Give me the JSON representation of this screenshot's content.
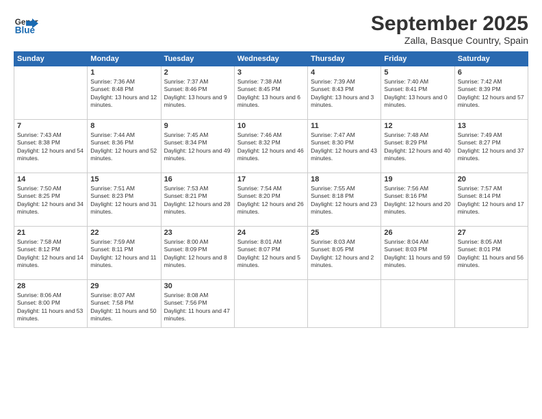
{
  "header": {
    "logo_general": "General",
    "logo_blue": "Blue",
    "title": "September 2025",
    "subtitle": "Zalla, Basque Country, Spain"
  },
  "days_of_week": [
    "Sunday",
    "Monday",
    "Tuesday",
    "Wednesday",
    "Thursday",
    "Friday",
    "Saturday"
  ],
  "weeks": [
    [
      {
        "date": "",
        "info": ""
      },
      {
        "date": "1",
        "sunrise": "Sunrise: 7:36 AM",
        "sunset": "Sunset: 8:48 PM",
        "daylight": "Daylight: 13 hours and 12 minutes."
      },
      {
        "date": "2",
        "sunrise": "Sunrise: 7:37 AM",
        "sunset": "Sunset: 8:46 PM",
        "daylight": "Daylight: 13 hours and 9 minutes."
      },
      {
        "date": "3",
        "sunrise": "Sunrise: 7:38 AM",
        "sunset": "Sunset: 8:45 PM",
        "daylight": "Daylight: 13 hours and 6 minutes."
      },
      {
        "date": "4",
        "sunrise": "Sunrise: 7:39 AM",
        "sunset": "Sunset: 8:43 PM",
        "daylight": "Daylight: 13 hours and 3 minutes."
      },
      {
        "date": "5",
        "sunrise": "Sunrise: 7:40 AM",
        "sunset": "Sunset: 8:41 PM",
        "daylight": "Daylight: 13 hours and 0 minutes."
      },
      {
        "date": "6",
        "sunrise": "Sunrise: 7:42 AM",
        "sunset": "Sunset: 8:39 PM",
        "daylight": "Daylight: 12 hours and 57 minutes."
      }
    ],
    [
      {
        "date": "7",
        "sunrise": "Sunrise: 7:43 AM",
        "sunset": "Sunset: 8:38 PM",
        "daylight": "Daylight: 12 hours and 54 minutes."
      },
      {
        "date": "8",
        "sunrise": "Sunrise: 7:44 AM",
        "sunset": "Sunset: 8:36 PM",
        "daylight": "Daylight: 12 hours and 52 minutes."
      },
      {
        "date": "9",
        "sunrise": "Sunrise: 7:45 AM",
        "sunset": "Sunset: 8:34 PM",
        "daylight": "Daylight: 12 hours and 49 minutes."
      },
      {
        "date": "10",
        "sunrise": "Sunrise: 7:46 AM",
        "sunset": "Sunset: 8:32 PM",
        "daylight": "Daylight: 12 hours and 46 minutes."
      },
      {
        "date": "11",
        "sunrise": "Sunrise: 7:47 AM",
        "sunset": "Sunset: 8:30 PM",
        "daylight": "Daylight: 12 hours and 43 minutes."
      },
      {
        "date": "12",
        "sunrise": "Sunrise: 7:48 AM",
        "sunset": "Sunset: 8:29 PM",
        "daylight": "Daylight: 12 hours and 40 minutes."
      },
      {
        "date": "13",
        "sunrise": "Sunrise: 7:49 AM",
        "sunset": "Sunset: 8:27 PM",
        "daylight": "Daylight: 12 hours and 37 minutes."
      }
    ],
    [
      {
        "date": "14",
        "sunrise": "Sunrise: 7:50 AM",
        "sunset": "Sunset: 8:25 PM",
        "daylight": "Daylight: 12 hours and 34 minutes."
      },
      {
        "date": "15",
        "sunrise": "Sunrise: 7:51 AM",
        "sunset": "Sunset: 8:23 PM",
        "daylight": "Daylight: 12 hours and 31 minutes."
      },
      {
        "date": "16",
        "sunrise": "Sunrise: 7:53 AM",
        "sunset": "Sunset: 8:21 PM",
        "daylight": "Daylight: 12 hours and 28 minutes."
      },
      {
        "date": "17",
        "sunrise": "Sunrise: 7:54 AM",
        "sunset": "Sunset: 8:20 PM",
        "daylight": "Daylight: 12 hours and 26 minutes."
      },
      {
        "date": "18",
        "sunrise": "Sunrise: 7:55 AM",
        "sunset": "Sunset: 8:18 PM",
        "daylight": "Daylight: 12 hours and 23 minutes."
      },
      {
        "date": "19",
        "sunrise": "Sunrise: 7:56 AM",
        "sunset": "Sunset: 8:16 PM",
        "daylight": "Daylight: 12 hours and 20 minutes."
      },
      {
        "date": "20",
        "sunrise": "Sunrise: 7:57 AM",
        "sunset": "Sunset: 8:14 PM",
        "daylight": "Daylight: 12 hours and 17 minutes."
      }
    ],
    [
      {
        "date": "21",
        "sunrise": "Sunrise: 7:58 AM",
        "sunset": "Sunset: 8:12 PM",
        "daylight": "Daylight: 12 hours and 14 minutes."
      },
      {
        "date": "22",
        "sunrise": "Sunrise: 7:59 AM",
        "sunset": "Sunset: 8:11 PM",
        "daylight": "Daylight: 12 hours and 11 minutes."
      },
      {
        "date": "23",
        "sunrise": "Sunrise: 8:00 AM",
        "sunset": "Sunset: 8:09 PM",
        "daylight": "Daylight: 12 hours and 8 minutes."
      },
      {
        "date": "24",
        "sunrise": "Sunrise: 8:01 AM",
        "sunset": "Sunset: 8:07 PM",
        "daylight": "Daylight: 12 hours and 5 minutes."
      },
      {
        "date": "25",
        "sunrise": "Sunrise: 8:03 AM",
        "sunset": "Sunset: 8:05 PM",
        "daylight": "Daylight: 12 hours and 2 minutes."
      },
      {
        "date": "26",
        "sunrise": "Sunrise: 8:04 AM",
        "sunset": "Sunset: 8:03 PM",
        "daylight": "Daylight: 11 hours and 59 minutes."
      },
      {
        "date": "27",
        "sunrise": "Sunrise: 8:05 AM",
        "sunset": "Sunset: 8:01 PM",
        "daylight": "Daylight: 11 hours and 56 minutes."
      }
    ],
    [
      {
        "date": "28",
        "sunrise": "Sunrise: 8:06 AM",
        "sunset": "Sunset: 8:00 PM",
        "daylight": "Daylight: 11 hours and 53 minutes."
      },
      {
        "date": "29",
        "sunrise": "Sunrise: 8:07 AM",
        "sunset": "Sunset: 7:58 PM",
        "daylight": "Daylight: 11 hours and 50 minutes."
      },
      {
        "date": "30",
        "sunrise": "Sunrise: 8:08 AM",
        "sunset": "Sunset: 7:56 PM",
        "daylight": "Daylight: 11 hours and 47 minutes."
      },
      {
        "date": "",
        "info": ""
      },
      {
        "date": "",
        "info": ""
      },
      {
        "date": "",
        "info": ""
      },
      {
        "date": "",
        "info": ""
      }
    ]
  ]
}
